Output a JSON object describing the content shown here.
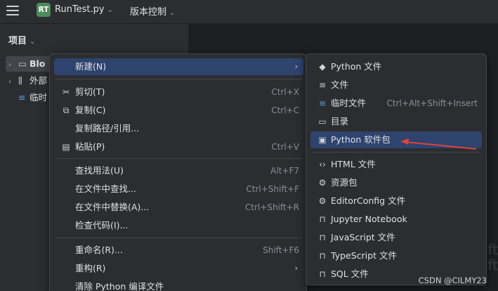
{
  "topbar": {
    "badge": "RT",
    "project_name": "RunTest.py",
    "vcs_label": "版本控制",
    "chevron": "⌄"
  },
  "sidebar": {
    "title": "项目",
    "chevron": "⌄",
    "items": [
      {
        "label": "Blo",
        "arrow": "›",
        "icon": "folder-icon"
      },
      {
        "label": "外部",
        "arrow": "›",
        "icon": "library-icon"
      },
      {
        "label": "临时",
        "arrow": "",
        "icon": "scratch-icon"
      }
    ]
  },
  "editor_ghost": [
    "ift",
    "ift"
  ],
  "context_menu": {
    "items": [
      {
        "label": "新建(N)",
        "shortcut": "",
        "submenu": true,
        "icon": "",
        "highlighted": true
      },
      {
        "label": "剪切(T)",
        "shortcut": "Ctrl+X",
        "icon": "scissors-icon"
      },
      {
        "label": "复制(C)",
        "shortcut": "Ctrl+C",
        "icon": "copy-icon"
      },
      {
        "label": "复制路径/引用...",
        "shortcut": "",
        "icon": ""
      },
      {
        "label": "粘贴(P)",
        "shortcut": "Ctrl+V",
        "icon": "paste-icon"
      },
      {
        "label": "查找用法(U)",
        "shortcut": "Alt+F7",
        "icon": ""
      },
      {
        "label": "在文件中查找...",
        "shortcut": "Ctrl+Shift+F",
        "icon": ""
      },
      {
        "label": "在文件中替换(A)...",
        "shortcut": "Ctrl+Shift+R",
        "icon": ""
      },
      {
        "label": "检查代码(I)...",
        "shortcut": "",
        "icon": ""
      },
      {
        "label": "重命名(R)...",
        "shortcut": "Shift+F6",
        "icon": ""
      },
      {
        "label": "重构(R)",
        "shortcut": "",
        "submenu": true,
        "icon": ""
      },
      {
        "label": "清除 Python 编译文件",
        "shortcut": "",
        "icon": ""
      }
    ]
  },
  "new_submenu": {
    "items": [
      {
        "label": "Python 文件",
        "shortcut": "",
        "icon": "python-icon"
      },
      {
        "label": "文件",
        "shortcut": "",
        "icon": "file-icon"
      },
      {
        "label": "临时文件",
        "shortcut": "Ctrl+Alt+Shift+Insert",
        "icon": "scratch-file-icon"
      },
      {
        "label": "目录",
        "shortcut": "",
        "icon": "folder-icon"
      },
      {
        "label": "Python 软件包",
        "shortcut": "",
        "icon": "python-package-icon",
        "highlighted": true
      },
      {
        "label": "HTML 文件",
        "shortcut": "",
        "icon": "html-icon"
      },
      {
        "label": "资源包",
        "shortcut": "",
        "icon": "resource-bundle-icon"
      },
      {
        "label": "EditorConfig 文件",
        "shortcut": "",
        "icon": "editorconfig-icon"
      },
      {
        "label": "Jupyter Notebook",
        "shortcut": "",
        "icon": "lock-icon"
      },
      {
        "label": "JavaScript 文件",
        "shortcut": "",
        "icon": "lock-icon"
      },
      {
        "label": "TypeScript 文件",
        "shortcut": "",
        "icon": "lock-icon"
      },
      {
        "label": "SQL 文件",
        "shortcut": "",
        "icon": "lock-icon"
      }
    ]
  },
  "annotation": {
    "color": "#e0433b"
  },
  "watermark": "CSDN @CILMY23"
}
